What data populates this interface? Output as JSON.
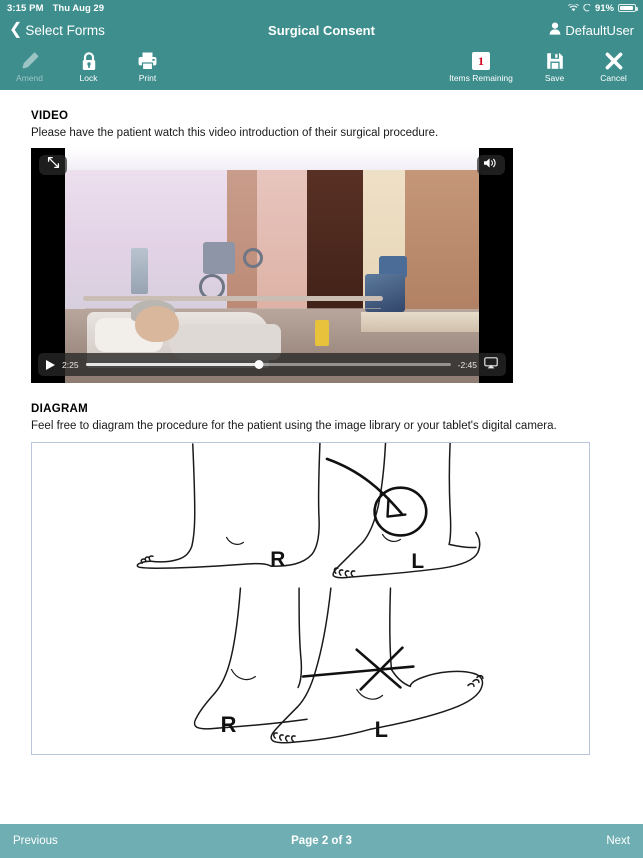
{
  "status_bar": {
    "time": "3:15 PM",
    "date": "Thu Aug 29",
    "battery_percent": "91%",
    "wifi_icon": "wifi-icon",
    "location_icon": "location-arrow-icon",
    "battery_icon": "battery-icon"
  },
  "nav": {
    "back_label": "Select Forms",
    "back_icon": "chevron-left-icon",
    "title": "Surgical Consent",
    "user_name": "DefaultUser",
    "user_icon": "person-icon"
  },
  "toolbar": {
    "left_items": [
      {
        "label": "Amend",
        "icon": "pencil-icon",
        "disabled": true
      },
      {
        "label": "Lock",
        "icon": "lock-icon",
        "disabled": false
      },
      {
        "label": "Print",
        "icon": "printer-icon",
        "disabled": false
      }
    ],
    "right_items": [
      {
        "label": "Items Remaining",
        "icon": "badge-count-icon",
        "badge": "1"
      },
      {
        "label": "Save",
        "icon": "floppy-disk-icon"
      },
      {
        "label": "Cancel",
        "icon": "x-close-icon"
      }
    ]
  },
  "sections": {
    "video": {
      "heading": "VIDEO",
      "description": "Please have the patient watch this video introduction of their surgical procedure.",
      "player": {
        "expand_icon": "fullscreen-expand-icon",
        "volume_icon": "speaker-volume-icon",
        "play_icon": "play-icon",
        "airplay_icon": "airplay-icon",
        "elapsed": "2:25",
        "remaining": "-2:45",
        "progress_percent": 47.5
      }
    },
    "diagram": {
      "heading": "DIAGRAM",
      "description": "Feel free to diagram the procedure for the patient using the image library or your tablet's digital camera.",
      "top_image": {
        "label_right_foot": "R",
        "label_left_foot": "L",
        "annotation": "circle-with-arrow-annotation"
      },
      "bottom_image": {
        "label_right_foot": "R",
        "label_left_foot": "L",
        "annotation": "x-mark-annotation"
      }
    }
  },
  "bottom_bar": {
    "previous_label": "Previous",
    "page_label": "Page 2 of 3",
    "next_label": "Next"
  },
  "colors": {
    "teal_header": "#3e8e8e",
    "teal_footer": "#6fafb3",
    "badge_red": "#d0021b",
    "diagram_border": "#b9c4dd"
  }
}
